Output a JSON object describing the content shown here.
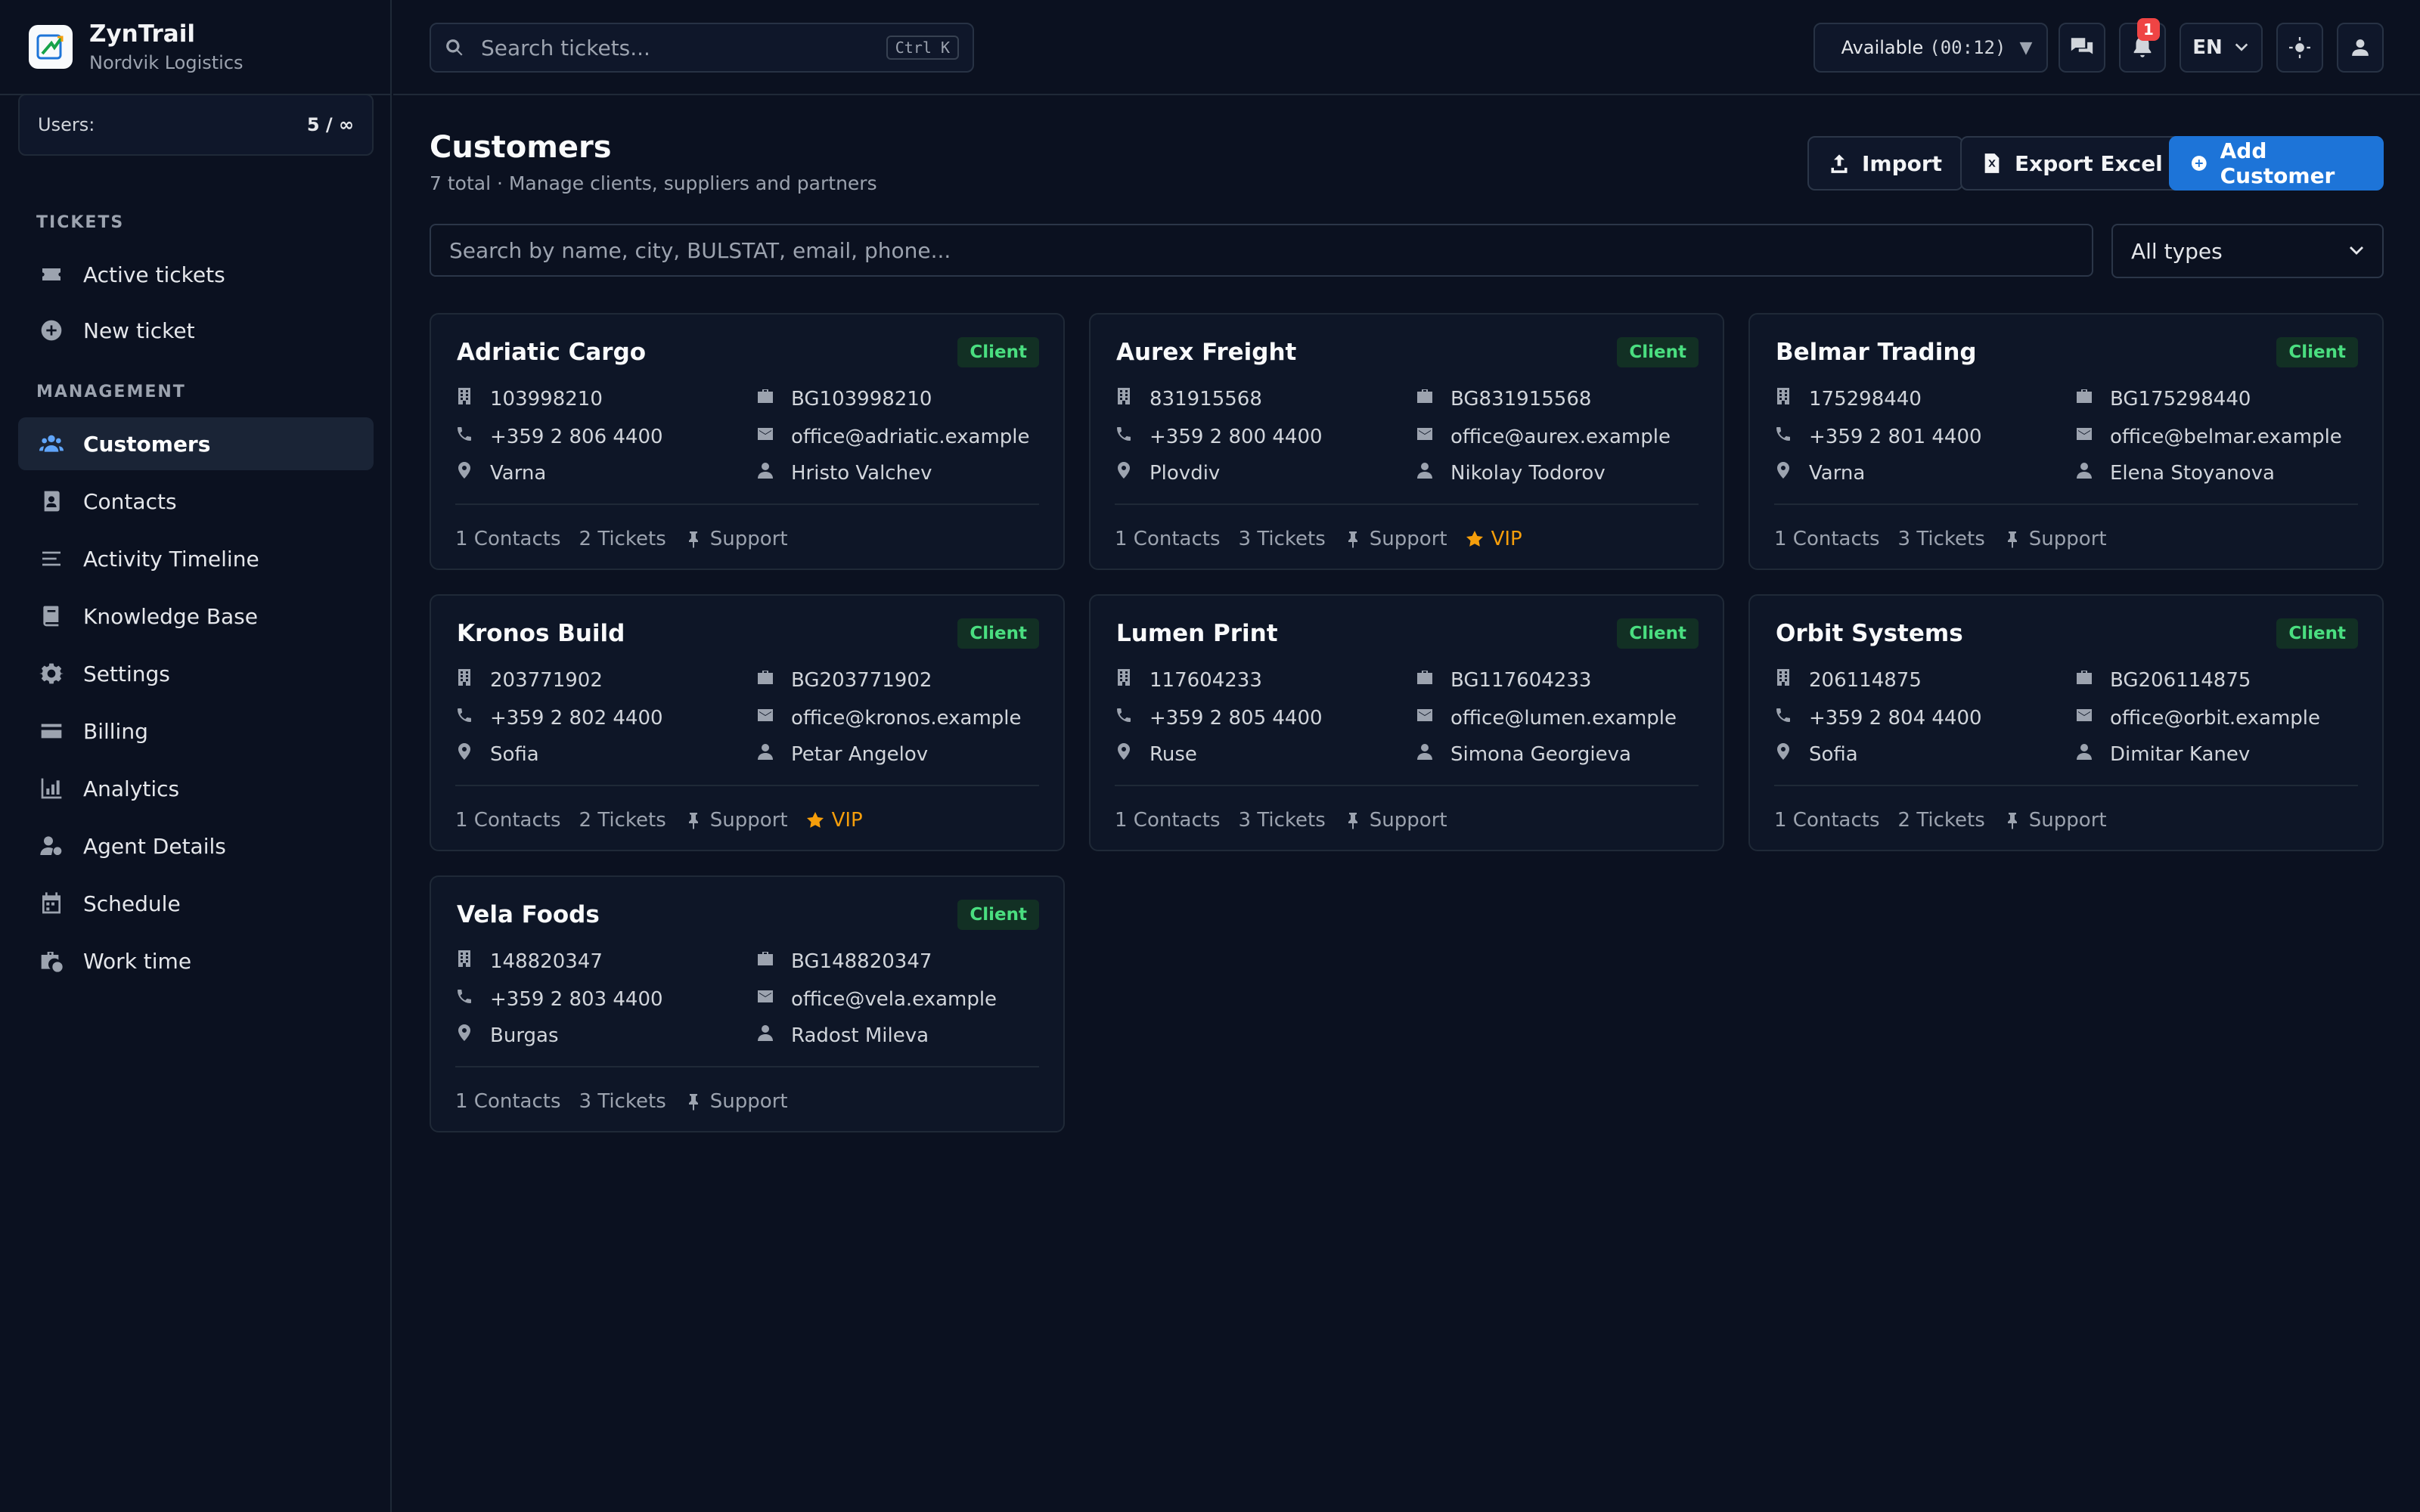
{
  "brand": {
    "name": "ZynTrail",
    "org": "Nordvik Logistics"
  },
  "users": {
    "label": "Users:",
    "value": "5 / ∞"
  },
  "nav": {
    "tickets_heading": "TICKETS",
    "tickets": [
      {
        "label": "Active tickets",
        "icon": "ticket-icon"
      },
      {
        "label": "New ticket",
        "icon": "plus-circle-icon"
      }
    ],
    "management_heading": "MANAGEMENT",
    "management": [
      {
        "label": "Customers",
        "icon": "users-icon",
        "active": true
      },
      {
        "label": "Contacts",
        "icon": "contact-card-icon"
      },
      {
        "label": "Activity Timeline",
        "icon": "timeline-icon"
      },
      {
        "label": "Knowledge Base",
        "icon": "book-icon"
      },
      {
        "label": "Settings",
        "icon": "gear-icon"
      },
      {
        "label": "Billing",
        "icon": "credit-card-icon"
      },
      {
        "label": "Analytics",
        "icon": "chart-icon"
      },
      {
        "label": "Agent Details",
        "icon": "user-gear-icon"
      },
      {
        "label": "Schedule",
        "icon": "calendar-icon"
      },
      {
        "label": "Work time",
        "icon": "briefcase-clock-icon"
      }
    ]
  },
  "topbar": {
    "search_placeholder": "Search tickets...",
    "search_shortcut": "Ctrl K",
    "status_label": "Available",
    "status_time": "(00:12)",
    "notifications_count": "1",
    "language": "EN"
  },
  "page": {
    "title": "Customers",
    "subtitle": "7 total · Manage clients, suppliers and partners",
    "import_label": "Import",
    "export_label": "Export Excel",
    "add_label": "Add Customer",
    "filter_placeholder": "Search by name, city, BULSTAT, email, phone...",
    "type_filter": "All types"
  },
  "customers": [
    {
      "name": "Adriatic Cargo",
      "type": "Client",
      "id": "103998210",
      "vat": "BG103998210",
      "phone": "+359 2 806 4400",
      "email": "office@adriatic.example",
      "city": "Varna",
      "person": "Hristo Valchev",
      "contacts": "1 Contacts",
      "tickets": "2 Tickets",
      "plan": "Support",
      "vip": ""
    },
    {
      "name": "Aurex Freight",
      "type": "Client",
      "id": "831915568",
      "vat": "BG831915568",
      "phone": "+359 2 800 4400",
      "email": "office@aurex.example",
      "city": "Plovdiv",
      "person": "Nikolay Todorov",
      "contacts": "1 Contacts",
      "tickets": "3 Tickets",
      "plan": "Support",
      "vip": "VIP"
    },
    {
      "name": "Belmar Trading",
      "type": "Client",
      "id": "175298440",
      "vat": "BG175298440",
      "phone": "+359 2 801 4400",
      "email": "office@belmar.example",
      "city": "Varna",
      "person": "Elena Stoyanova",
      "contacts": "1 Contacts",
      "tickets": "3 Tickets",
      "plan": "Support",
      "vip": ""
    },
    {
      "name": "Kronos Build",
      "type": "Client",
      "id": "203771902",
      "vat": "BG203771902",
      "phone": "+359 2 802 4400",
      "email": "office@kronos.example",
      "city": "Sofia",
      "person": "Petar Angelov",
      "contacts": "1 Contacts",
      "tickets": "2 Tickets",
      "plan": "Support",
      "vip": "VIP"
    },
    {
      "name": "Lumen Print",
      "type": "Client",
      "id": "117604233",
      "vat": "BG117604233",
      "phone": "+359 2 805 4400",
      "email": "office@lumen.example",
      "city": "Ruse",
      "person": "Simona Georgieva",
      "contacts": "1 Contacts",
      "tickets": "3 Tickets",
      "plan": "Support",
      "vip": ""
    },
    {
      "name": "Orbit Systems",
      "type": "Client",
      "id": "206114875",
      "vat": "BG206114875",
      "phone": "+359 2 804 4400",
      "email": "office@orbit.example",
      "city": "Sofia",
      "person": "Dimitar Kanev",
      "contacts": "1 Contacts",
      "tickets": "2 Tickets",
      "plan": "Support",
      "vip": ""
    },
    {
      "name": "Vela Foods",
      "type": "Client",
      "id": "148820347",
      "vat": "BG148820347",
      "phone": "+359 2 803 4400",
      "email": "office@vela.example",
      "city": "Burgas",
      "person": "Radost Mileva",
      "contacts": "1 Contacts",
      "tickets": "3 Tickets",
      "plan": "Support",
      "vip": ""
    }
  ]
}
